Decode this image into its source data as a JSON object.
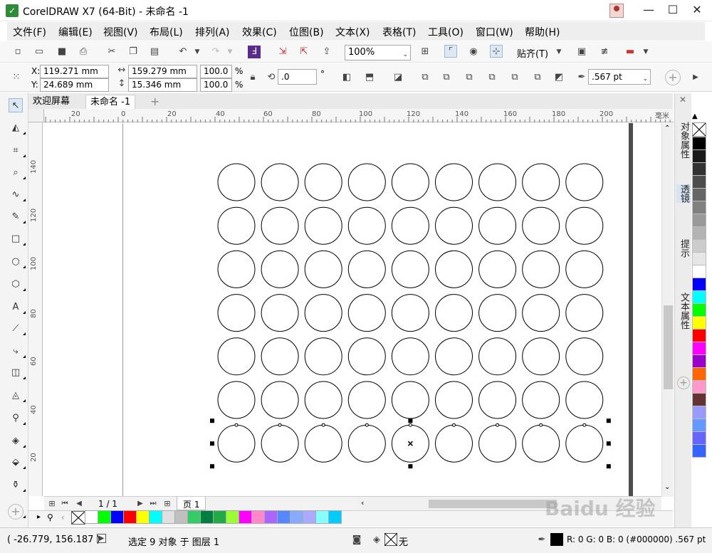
{
  "window": {
    "title": "CorelDRAW X7 (64-Bit) - 未命名 -1"
  },
  "menu": [
    "文件(F)",
    "编辑(E)",
    "视图(V)",
    "布局(L)",
    "排列(A)",
    "效果(C)",
    "位图(B)",
    "文本(X)",
    "表格(T)",
    "工具(O)",
    "窗口(W)",
    "帮助(H)"
  ],
  "toolbar": {
    "zoom": "100%",
    "snap_label": "贴齐(T)"
  },
  "props": {
    "x_label": "X:",
    "x_value": "119.271 mm",
    "y_label": "Y:",
    "y_value": "24.689 mm",
    "w_value": "159.279 mm",
    "h_value": "15.346 mm",
    "scale_w": "100.0",
    "scale_h": "100.0",
    "pct": "%",
    "rotation": ".0",
    "degree": "°",
    "outline_width": ".567 pt"
  },
  "tabs": {
    "welcome": "欢迎屏幕",
    "doc": "未命名 -1",
    "add": "+"
  },
  "ruler": {
    "h_ticks": [
      "20",
      "0",
      "20",
      "40",
      "60",
      "80",
      "100",
      "120",
      "140",
      "160",
      "180",
      "200"
    ],
    "unit": "毫米",
    "v_ticks": [
      "140",
      "120",
      "100",
      "80",
      "60",
      "40",
      "20"
    ]
  },
  "page_nav": {
    "page_count": "1 / 1",
    "page_tab": "页 1"
  },
  "dockers": [
    "对象属性",
    "透镜",
    "提示",
    "文本属性"
  ],
  "palette_vertical": [
    "#000000",
    "#1a1a1a",
    "#333333",
    "#4d4d4d",
    "#666666",
    "#808080",
    "#999999",
    "#b3b3b3",
    "#cccccc",
    "#e6e6e6",
    "#ffffff",
    "#0000ff",
    "#00ffff",
    "#00ff00",
    "#ffff00",
    "#ff0000",
    "#ff00ff",
    "#9900cc",
    "#ff6600",
    "#ff99cc",
    "#663333",
    "#9999ff",
    "#6699ff",
    "#6666ff",
    "#3366ff"
  ],
  "palette_horizontal": [
    "#ffffff",
    "#00ff00",
    "#0000ff",
    "#ff0000",
    "#ffff00",
    "#00ffff",
    "#e0e0e0",
    "#c0c0c0",
    "#33cc66",
    "#008040",
    "#22aa44",
    "#99ff33",
    "#ff00ff",
    "#ff88cc",
    "#aa66ff",
    "#5588ff",
    "#88aaff",
    "#aaaaff",
    "#88ffff",
    "#00ccff"
  ],
  "status": {
    "coords": "( -26.779, 156.187 )",
    "selection": "选定 9 对象 于 图层 1",
    "fill": "无",
    "outline": "R: 0 G: 0 B: 0 (#000000)  .567 pt"
  },
  "grid": {
    "rows": 7,
    "cols": 9,
    "selected_row": 7
  },
  "watermark": "Baidu 经验"
}
